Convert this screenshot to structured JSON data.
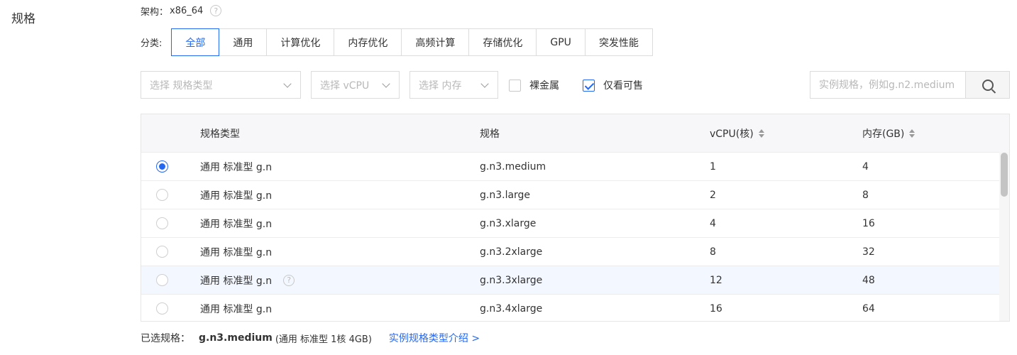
{
  "section": {
    "label": "规格"
  },
  "architecture": {
    "label": "架构：",
    "value": "x86_64",
    "help": "?"
  },
  "category": {
    "label": "分类:",
    "tabs": [
      {
        "label": "全部",
        "active": true
      },
      {
        "label": "通用",
        "active": false
      },
      {
        "label": "计算优化",
        "active": false
      },
      {
        "label": "内存优化",
        "active": false
      },
      {
        "label": "高频计算",
        "active": false
      },
      {
        "label": "存储优化",
        "active": false
      },
      {
        "label": "GPU",
        "active": false
      },
      {
        "label": "突发性能",
        "active": false
      }
    ]
  },
  "filters": {
    "spec_type_placeholder": "选择 规格类型",
    "vcpu_placeholder": "选择 vCPU",
    "memory_placeholder": "选择 内存",
    "bare_metal": {
      "label": "裸金属",
      "checked": false
    },
    "only_available": {
      "label": "仅看可售",
      "checked": true
    },
    "search_placeholder": "实例规格，例如g.n2.medium"
  },
  "table": {
    "headers": {
      "type": "规格类型",
      "spec": "规格",
      "vcpu": "vCPU(核)",
      "memory": "内存(GB)"
    },
    "rows": [
      {
        "type": "通用 标准型 g.n",
        "spec": "g.n3.medium",
        "vcpu": "1",
        "memory": "4",
        "selected": true,
        "help": false
      },
      {
        "type": "通用 标准型 g.n",
        "spec": "g.n3.large",
        "vcpu": "2",
        "memory": "8",
        "selected": false,
        "help": false
      },
      {
        "type": "通用 标准型 g.n",
        "spec": "g.n3.xlarge",
        "vcpu": "4",
        "memory": "16",
        "selected": false,
        "help": false
      },
      {
        "type": "通用 标准型 g.n",
        "spec": "g.n3.2xlarge",
        "vcpu": "8",
        "memory": "32",
        "selected": false,
        "help": false
      },
      {
        "type": "通用 标准型 g.n",
        "spec": "g.n3.3xlarge",
        "vcpu": "12",
        "memory": "48",
        "selected": false,
        "help": true
      },
      {
        "type": "通用 标准型 g.n",
        "spec": "g.n3.4xlarge",
        "vcpu": "16",
        "memory": "64",
        "selected": false,
        "help": false
      }
    ]
  },
  "summary": {
    "label": "已选规格：",
    "spec": "g.n3.medium",
    "desc": "(通用 标准型 1核 4GB)",
    "link": "实例规格类型介绍 >"
  },
  "colors": {
    "accent": "#2468f2",
    "border": "#dcdcdc",
    "header_bg": "#f7f7f9",
    "hover_bg": "#f3f7ff"
  },
  "icons": {
    "help": "question-circle-icon",
    "search": "magnifier-icon",
    "dropdown": "chevron-down-icon",
    "sort": "sort-icon"
  }
}
